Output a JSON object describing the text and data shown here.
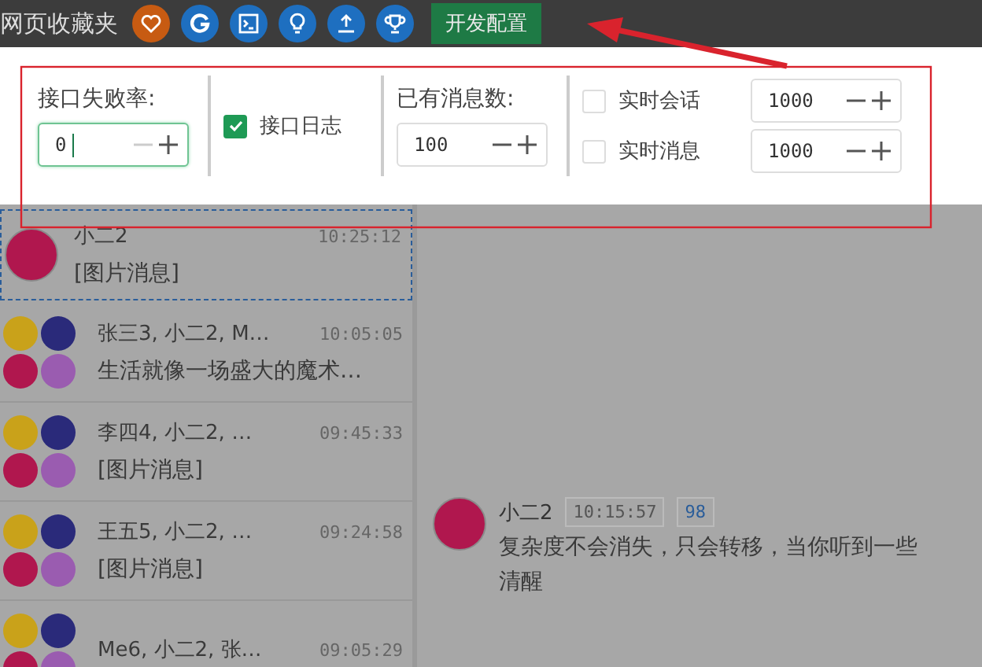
{
  "top_bar": {
    "title": "网页收藏夹",
    "icon_buttons": [
      {
        "kind": "heart"
      },
      {
        "kind": "g"
      },
      {
        "kind": "terminal"
      },
      {
        "kind": "bulb"
      },
      {
        "kind": "upload"
      },
      {
        "kind": "trophy"
      }
    ],
    "dev_button": "开发配置"
  },
  "dev_panel": {
    "failure_rate": {
      "label": "接口失败率:",
      "value": "0",
      "focused": true,
      "minus_disabled": true
    },
    "api_log": {
      "label": "接口日志",
      "checked": true
    },
    "message_count": {
      "label": "已有消息数:",
      "value": "100",
      "focused": false,
      "minus_disabled": false
    },
    "realtime": [
      {
        "label": "实时会话",
        "checked": false,
        "value": "1000"
      },
      {
        "label": "实时消息",
        "checked": false,
        "value": "1000"
      }
    ]
  },
  "conversations": [
    {
      "kind": "single",
      "name": "小二2",
      "time": "10:25:12",
      "preview": "[图片消息]",
      "selected": true
    },
    {
      "kind": "group",
      "name": "张三3, 小二2, M…",
      "time": "10:05:05",
      "preview": "生活就像一场盛大的魔术…",
      "selected": false
    },
    {
      "kind": "group",
      "name": "李四4, 小二2, …",
      "time": "09:45:33",
      "preview": "[图片消息]",
      "selected": false
    },
    {
      "kind": "group",
      "name": "王五5, 小二2, …",
      "time": "09:24:58",
      "preview": "[图片消息]",
      "selected": false
    },
    {
      "kind": "group",
      "name": "Me6, 小二2, 张…",
      "time": "09:05:29",
      "selected": false
    }
  ],
  "message": {
    "sender": "小二2",
    "time": "10:15:57",
    "count": "98",
    "lines": [
      "复杂度不会消失，只会转移，当你听到一些",
      "清醒"
    ]
  }
}
